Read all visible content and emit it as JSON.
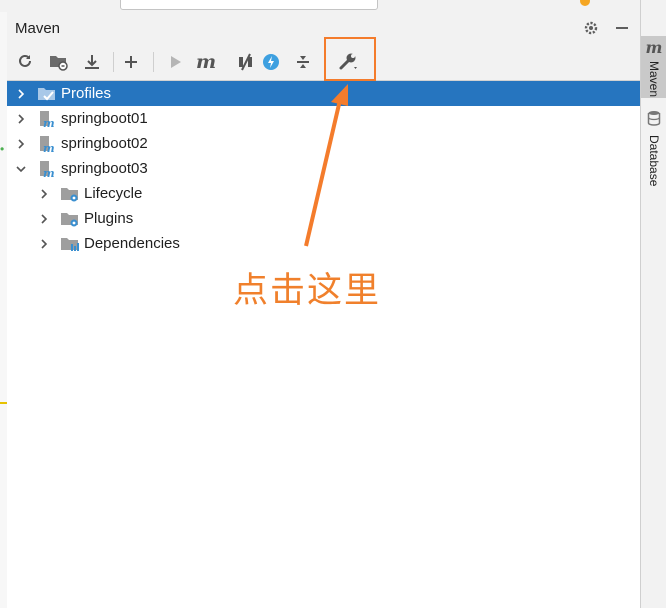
{
  "panel": {
    "title": "Maven",
    "header_buttons": [
      {
        "icon": "gear-icon"
      },
      {
        "icon": "minimize-icon"
      }
    ]
  },
  "toolbar": {
    "buttons": [
      {
        "icon": "reload-icon"
      },
      {
        "icon": "generate-sources-folder-icon"
      },
      {
        "icon": "download-icon"
      },
      {
        "icon": "add-icon"
      },
      {
        "icon": "run-icon"
      },
      {
        "icon": "maven-goal-icon",
        "glyph": "m"
      },
      {
        "icon": "toggle-offline-icon"
      },
      {
        "icon": "skip-tests-icon"
      },
      {
        "icon": "collapse-all-icon"
      },
      {
        "icon": "maven-settings-wrench-icon"
      }
    ]
  },
  "tree": {
    "items": [
      {
        "label": "Profiles",
        "expanded": false,
        "selected": true,
        "level": 0,
        "icon": "profiles-icon"
      },
      {
        "label": "springboot01",
        "expanded": false,
        "selected": false,
        "level": 0,
        "icon": "maven-project-icon"
      },
      {
        "label": "springboot02",
        "expanded": false,
        "selected": false,
        "level": 0,
        "icon": "maven-project-icon"
      },
      {
        "label": "springboot03",
        "expanded": true,
        "selected": false,
        "level": 0,
        "icon": "maven-project-icon"
      },
      {
        "label": "Lifecycle",
        "expanded": false,
        "selected": false,
        "level": 1,
        "icon": "lifecycle-folder-icon"
      },
      {
        "label": "Plugins",
        "expanded": false,
        "selected": false,
        "level": 1,
        "icon": "plugins-folder-icon"
      },
      {
        "label": "Dependencies",
        "expanded": false,
        "selected": false,
        "level": 1,
        "icon": "dependencies-folder-icon"
      }
    ]
  },
  "annotation": {
    "text": "点击这里"
  },
  "right_bar": {
    "tabs": [
      {
        "label": "Maven",
        "icon": "maven-icon",
        "active": true
      },
      {
        "label": "Database",
        "icon": "database-icon",
        "active": false
      }
    ]
  },
  "colors": {
    "selection": "#2675bf",
    "annotation": "#f47c2c",
    "panel_bg": "#f2f2f2"
  }
}
